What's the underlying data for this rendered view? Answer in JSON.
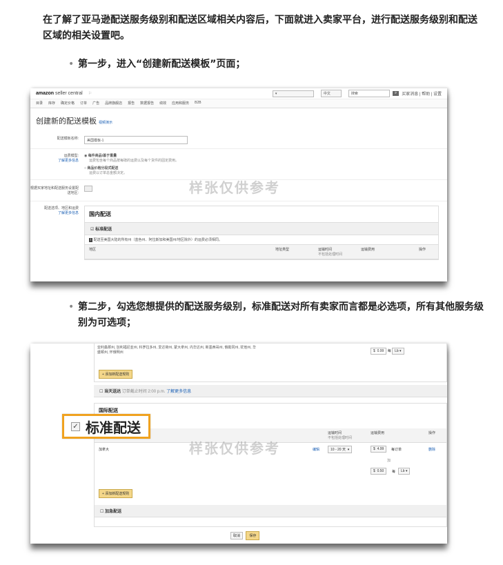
{
  "intro": "在了解了亚马逊配送服务级别和配送区域相关内容后，下面就进入卖家平台，进行配送服务级别和配送区域的相关设置吧。",
  "step1": "第一步，进入“创建新配送模板”页面；",
  "step2": "第二步，勾选您想提供的配送服务级别，标准配送对所有卖家而言都是必选项，所有其他服务级别为可选项；",
  "bullet": "•",
  "watermark": "样张仅供参考",
  "shot1": {
    "logo_main": "amazon",
    "logo_sub": " seller central",
    "lang": "中文",
    "search": "搜索",
    "top_links": "买家消息 | 帮助 | 设置",
    "nav": [
      "目录",
      "库存",
      "确定价格",
      "订单",
      "广告",
      "品牌旗舰店",
      "报告",
      "数据报告",
      "绩效",
      "应用和服务",
      "B2B"
    ],
    "title": "创建新的配送模板",
    "title_link": "视频演示",
    "name_label": "配送模板名称:",
    "name_value": "美国模板-1",
    "rule_label": "运费模型:",
    "rule_link": "了解更多信息",
    "opt1": "每件商品/基于重量",
    "opt1_sub": "运费包含每个商品按每磅的运费以及每个货件的固定费用。",
    "opt2": "商品价格分段式配送",
    "opt2_sub": "运费以订单总金额决定。",
    "addr_label": "根据买家地址和配送服务设置配送地区:",
    "zone_label": "配送选项、地区和运费",
    "zone_link": "了解更多信息",
    "domestic": "国内配送",
    "standard": "标准配送",
    "note": "配送至美国大陆的所有州（蓝色州、阿拉斯加和美国州/地区除外）的运费必须相同。",
    "cols": [
      "地区",
      "地址类型",
      "运输时间",
      "运输费用",
      "操作"
    ],
    "cols_sub": "不包括处理时间"
  },
  "shot2": {
    "region_text": "亚利桑那州, 加利福尼亚州, 科罗拉多州, 爱达荷州, 蒙大拿州, 内华达州, 新墨西哥州, 俄勒冈州, 犹他州, 华盛顿州, 怀俄明州",
    "price1": "0.99",
    "per": "每",
    "unit": "Lb",
    "add_rule": "+ 添加新配送规则",
    "same_day": "当天送达",
    "same_day_note": "订单截止时间 2:00 p.m.",
    "same_day_link": "了解更多信息",
    "intl": "国际配送",
    "callout": "标准配送",
    "cols": [
      "地区",
      "运输时间",
      "运输费用",
      "操作"
    ],
    "cols_sub": "不包括处理时间",
    "region": "加拿大",
    "edit": "编辑",
    "transit": "10 - 20 天",
    "price2": "4.99",
    "per_order": "每订单",
    "plus": "加",
    "price3": "0.50",
    "delete": "删除",
    "expedited": "加急配送",
    "cancel": "取消",
    "save": "保存"
  }
}
